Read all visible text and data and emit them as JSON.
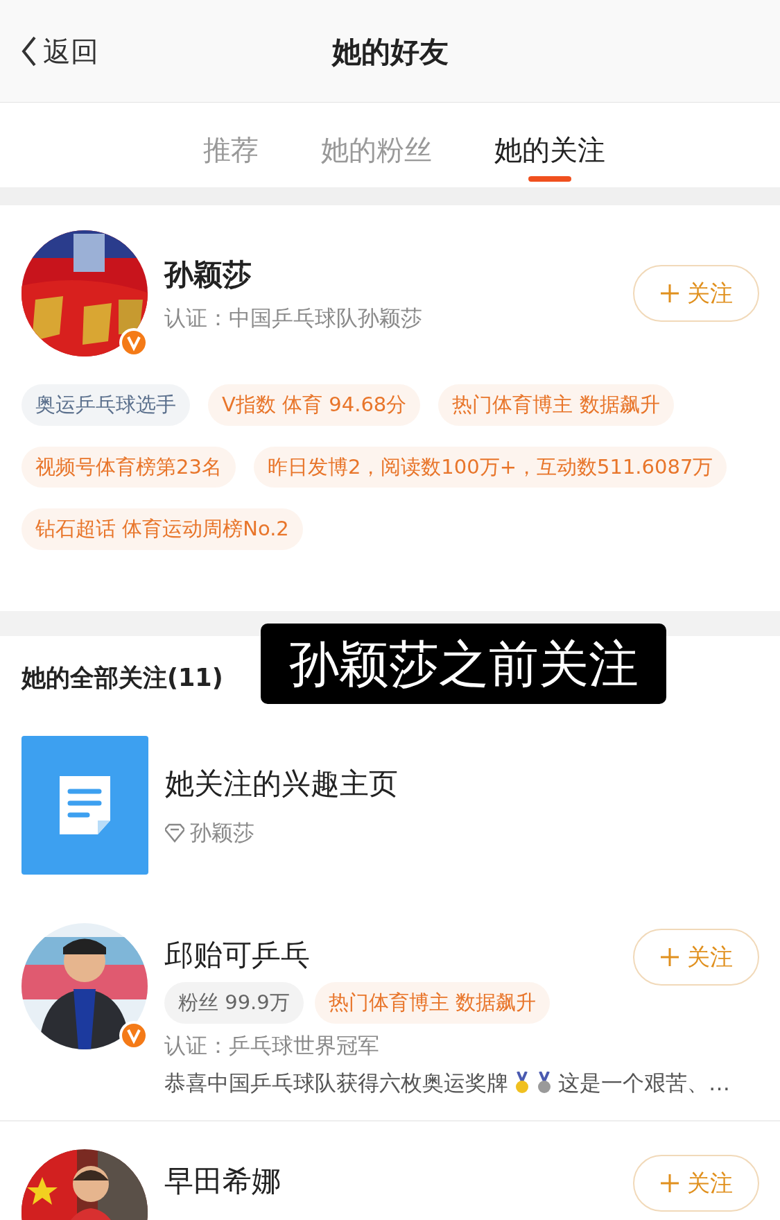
{
  "header": {
    "back": "返回",
    "title": "她的好友"
  },
  "tabs": [
    {
      "label": "推荐",
      "selected": false
    },
    {
      "label": "她的粉丝",
      "selected": false
    },
    {
      "label": "她的关注",
      "selected": true
    }
  ],
  "profile": {
    "name": "孙颖莎",
    "verified": true,
    "certification": "认证：中国乒乓球队孙颖莎",
    "follow": "关注",
    "avatar": {
      "kind": "picture"
    },
    "tags": [
      {
        "text": "奥运乒乓球选手",
        "color": "#5a6f8c"
      },
      {
        "text": "V指数 体育 94.68分",
        "color": "#e8752a"
      },
      {
        "text": "热门体育博主 数据飙升",
        "color": "#e8752a"
      },
      {
        "text": "视频号体育榜第23名",
        "color": "#e8752a"
      },
      {
        "text": "昨日发博2，阅读数100万+，互动数511.6087万",
        "color": "#e8752a"
      },
      {
        "text": "钻石超话 体育运动周榜No.2",
        "color": "#e8752a"
      }
    ]
  },
  "following": {
    "title": "她的全部关注(11)",
    "caption": "孙颖莎之前关注",
    "items": [
      {
        "kind": "page",
        "name": "她关注的兴趣主页",
        "owner": "孙颖莎"
      },
      {
        "kind": "user",
        "name": "邱贻可乒乓",
        "verified": true,
        "avatar": {
          "kind": "picture"
        },
        "follow": "关注",
        "tags": [
          {
            "text": "粉丝 99.9万",
            "color": "#666666"
          },
          {
            "text": "热门体育博主 数据飙升",
            "color": "#e8752a"
          }
        ],
        "certification": "认证：乒乓球世界冠军",
        "bio": [
          "恭喜中国乒乓球队获得六枚奥运奖牌",
          "这是一个艰苦、…"
        ]
      },
      {
        "kind": "user",
        "name": "早田希娜",
        "avatar": {
          "kind": "picture"
        },
        "follow": "关注"
      }
    ]
  }
}
